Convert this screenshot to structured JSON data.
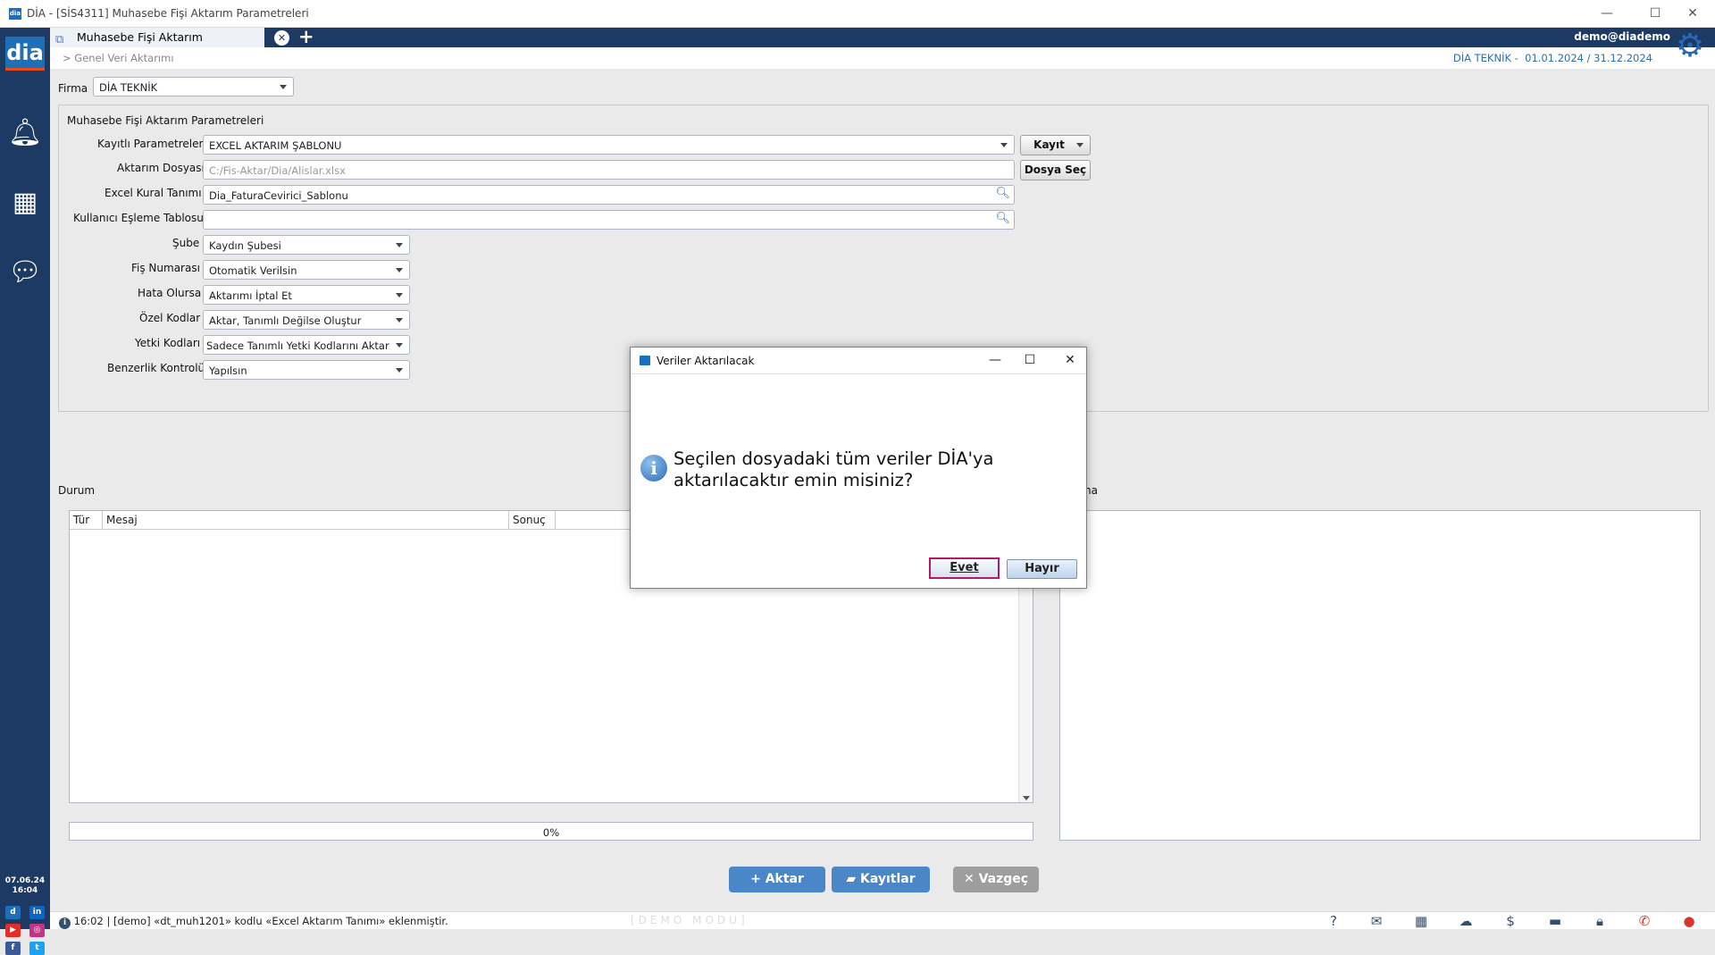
{
  "window": {
    "title": "DİA - [SİS4311] Muhasebe Fişi Aktarım Parametreleri"
  },
  "tabs": {
    "active_label": "Muhasebe Fişi Aktarım Parametreleri",
    "user": "demo@diademo"
  },
  "sidebar": {
    "logo": "dia",
    "date": "07.06.24",
    "time": "16:04"
  },
  "header": {
    "breadcrumb": "> Genel Veri Aktarımı",
    "company": "DİA TEKNİK -",
    "period": "01.01.2024 / 31.12.2024"
  },
  "firma": {
    "label": "Firma",
    "value": "DİA TEKNİK"
  },
  "params": {
    "group_title": "Muhasebe Fişi Aktarım Parametreleri",
    "kayitli": {
      "label": "Kayıtlı Parametreler",
      "value": "EXCEL AKTARIM ŞABLONU"
    },
    "save_button": "Kayıt",
    "dosya": {
      "label": "Aktarım Dosyası",
      "placeholder": "C:/Fis-Aktar/Dia/Alislar.xlsx"
    },
    "dosya_button": "Dosya Seç",
    "kural": {
      "label": "Excel Kural Tanımı",
      "value": "Dia_FaturaCevirici_Sablonu"
    },
    "esleme": {
      "label": "Kullanıcı Eşleme Tablosu",
      "value": ""
    },
    "sube": {
      "label": "Şube",
      "value": "Kaydın Şubesi"
    },
    "fisno": {
      "label": "Fiş Numarası",
      "value": "Otomatik Verilsin"
    },
    "hata": {
      "label": "Hata Olursa",
      "value": "Aktarımı İptal Et"
    },
    "ozel": {
      "label": "Özel Kodlar",
      "value": "Aktar, Tanımlı Değilse Oluştur"
    },
    "yetki": {
      "label": "Yetki Kodları",
      "value": "Sadece Tanımlı Yetki Kodlarını Aktar"
    },
    "benzerlik": {
      "label": "Benzerlik Kontrolü",
      "value": "Yapılsın"
    }
  },
  "durum": {
    "label": "Durum",
    "columns": [
      "Tür",
      "Mesaj",
      "Sonuç"
    ],
    "progress_text": "0%",
    "progress": 0
  },
  "right_panel": {
    "label_fragment": "na"
  },
  "actions": {
    "aktar": "Aktar",
    "kayitlar": "Kayıtlar",
    "vazgec": "Vazgeç"
  },
  "status": {
    "message": "16:02 | [demo] «dt_muh1201» kodlu «Excel Aktarım Tanımı» eklenmiştir.",
    "mode": "[DEMO MODU]"
  },
  "dialog": {
    "title": "Veriler Aktarılacak",
    "message": "Seçilen dosyadaki tüm veriler DİA'ya aktarılacaktır emin misiniz?",
    "yes": "Evet",
    "no": "Hayır"
  },
  "colors": {
    "navy": "#1c3a63",
    "accent_blue": "#4a86c8",
    "cancel_gray": "#9e9e9e",
    "focus_border": "#b5176a"
  }
}
